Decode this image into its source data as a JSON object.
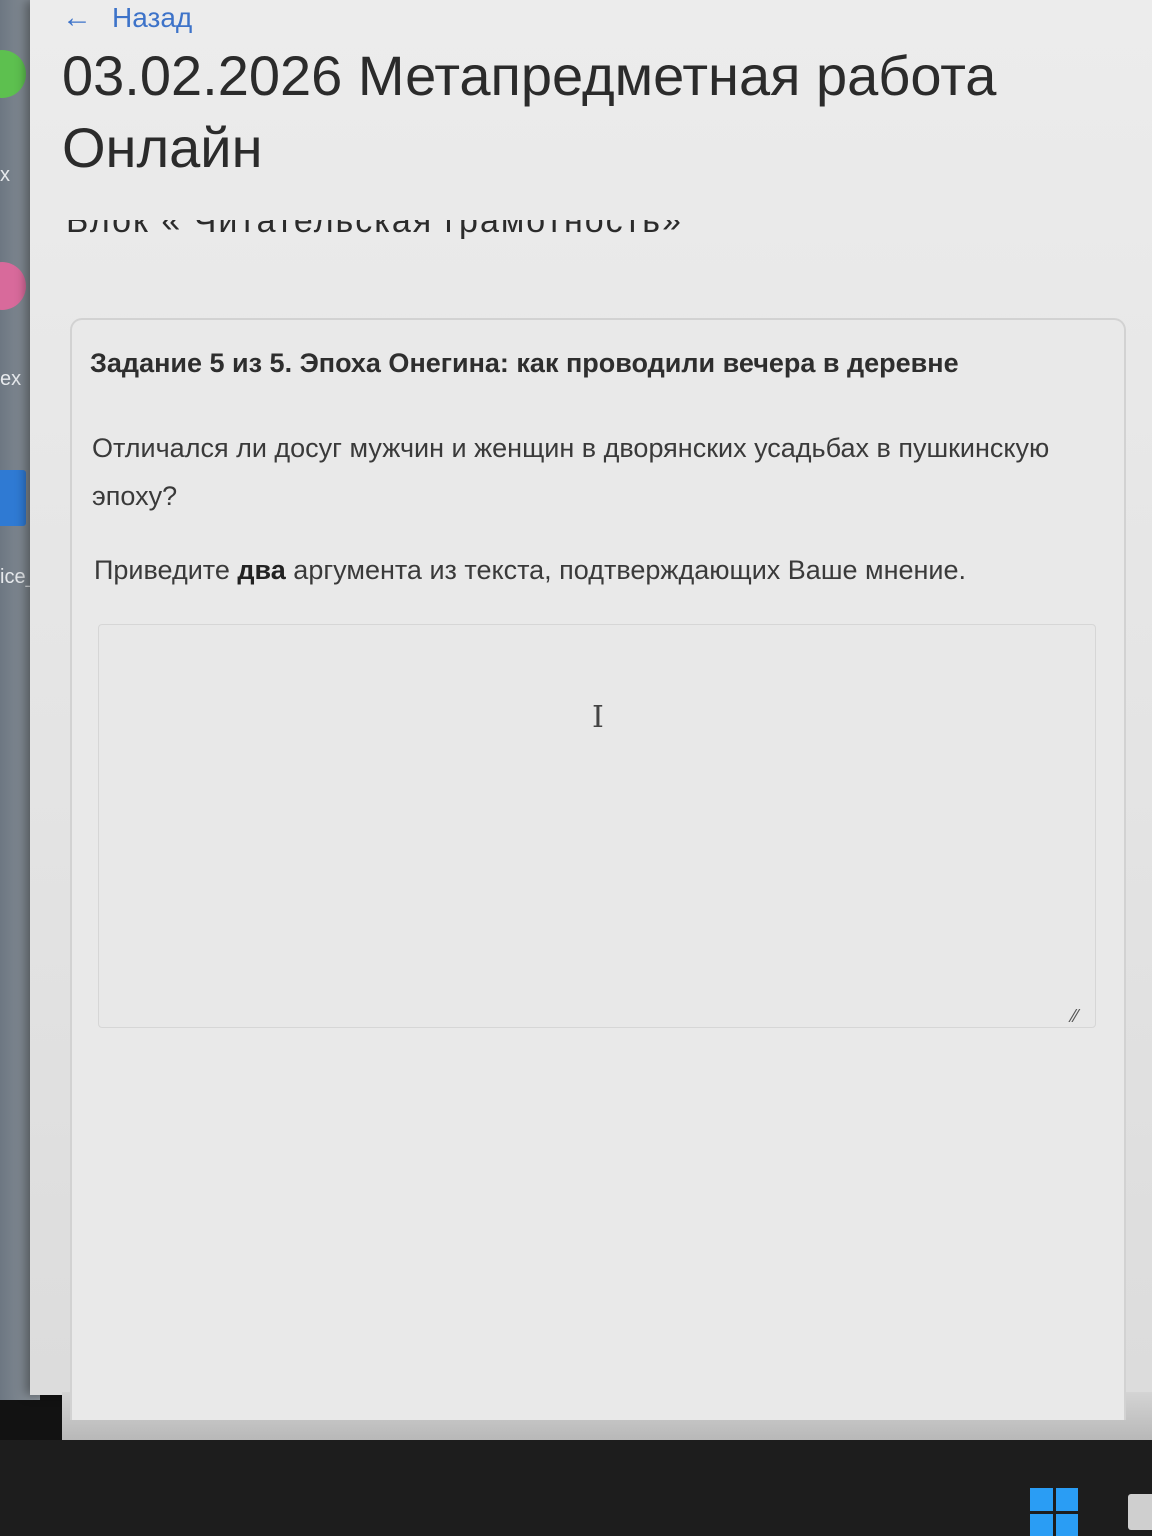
{
  "nav": {
    "back_arrow": "←",
    "back_label": "Назад"
  },
  "page": {
    "title": "03.02.2026 Метапредметная работа Онлайн",
    "block_label": "Блок « Читательская грамотность»"
  },
  "task": {
    "header": "Задание 5 из 5. Эпоха Онегина: как проводили вечера в деревне",
    "question": "Отличался ли досуг мужчин и женщин в дворянских усадьбах в пушкинскую эпоху?",
    "instruction_before": "Приведите ",
    "instruction_bold": "два",
    "instruction_after": " аргумента из текста, подтверждающих Ваше мнение.",
    "answer_value": ""
  },
  "desktop": {
    "labels": [
      "x",
      "ex",
      "ice_"
    ]
  },
  "colors": {
    "link": "#3d73c9",
    "page_bg": "#ececec",
    "taskbar": "#1d1d1d",
    "windows_logo": "#2a9df4"
  },
  "icons": {
    "back": "arrow-left-icon",
    "resize": "resize-handle-icon",
    "cursor": "text-cursor-icon",
    "start": "windows-logo-icon"
  }
}
